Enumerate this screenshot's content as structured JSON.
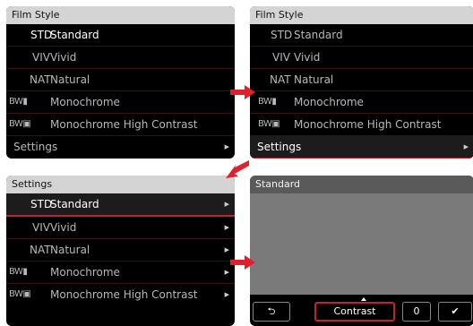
{
  "panel1": {
    "title": "Film Style",
    "items": [
      {
        "abbr": "STD",
        "label": "Standard"
      },
      {
        "abbr": "VIV",
        "label": "Vivid"
      },
      {
        "abbr": "NAT",
        "label": "Natural"
      },
      {
        "abbr": "BW▮",
        "label": "Monochrome"
      },
      {
        "abbr": "BW▣",
        "label": "Monochrome High Contrast"
      }
    ],
    "settings_label": "Settings"
  },
  "panel2": {
    "title": "Film Style",
    "items": [
      {
        "abbr": "STD",
        "label": "Standard"
      },
      {
        "abbr": "VIV",
        "label": "Vivid"
      },
      {
        "abbr": "NAT",
        "label": "Natural"
      },
      {
        "abbr": "BW▮",
        "label": "Monochrome"
      },
      {
        "abbr": "BW▣",
        "label": "Monochrome High Contrast"
      }
    ],
    "settings_label": "Settings"
  },
  "panel3": {
    "title": "Settings",
    "items": [
      {
        "abbr": "STD",
        "label": "Standard"
      },
      {
        "abbr": "VIV",
        "label": "Vivid"
      },
      {
        "abbr": "NAT",
        "label": "Natural"
      },
      {
        "abbr": "BW▮",
        "label": "Monochrome"
      },
      {
        "abbr": "BW▣",
        "label": "Monochrome High Contrast"
      }
    ]
  },
  "panel4": {
    "title": "Standard",
    "back_icon": "⮌",
    "contrast_label": "Contrast",
    "value": "0",
    "check_icon": "✔"
  },
  "colors": {
    "accent": "#c8202a",
    "arrow": "#e0202c"
  },
  "icons": {
    "arrow": "red-arrow-icon",
    "chevron": "chevron-right-icon",
    "back": "back-icon",
    "check": "check-icon",
    "up": "triangle-up-icon"
  }
}
